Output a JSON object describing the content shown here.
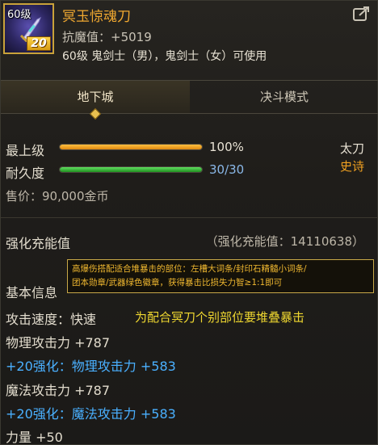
{
  "item": {
    "level_badge": "60级",
    "upgrade_badge": "20",
    "name": "冥玉惊魂刀",
    "resist": "抗魔值：+5019",
    "usable": "60级 鬼剑士（男），鬼剑士（女）可使用"
  },
  "tabs": [
    {
      "label": "地下城",
      "active": true
    },
    {
      "label": "决斗模式",
      "active": false
    }
  ],
  "bars": {
    "max_level_label": "最上级",
    "max_level_value": "100%",
    "max_level_fraction": 1.0,
    "durability_label": "耐久度",
    "durability_value": "30/30",
    "durability_fraction": 1.0
  },
  "weapon_type": "太刀",
  "rarity": "史诗",
  "price": "售价：90,000金币",
  "enhance": {
    "label": "强化充能值",
    "value": "（强化充能值：14110638）"
  },
  "tooltip": {
    "line1": "高爆伤搭配适合堆暴击的部位：左槽大词条/封印石精髓小词条/",
    "line2": "团本勋章/武器绿色徽章，获得暴击比损失力智≥1:1即可"
  },
  "basic_info": {
    "title": "基本信息",
    "attack_speed": "攻击速度：快速",
    "note": "为配合冥刀个别部位要堆叠暴击",
    "phys": "物理攻击力 +787",
    "phys_enh": "+20强化：物理攻击力 +583",
    "magic": "魔法攻击力 +787",
    "magic_enh": "+20强化：魔法攻击力 +583",
    "strength": "力量 +50"
  },
  "colors": {
    "name": "#f0a830",
    "bar_orange": "#f0a020",
    "bar_green": "#40c040",
    "rarity": "#f0a020",
    "enhance_blue": "#4ab0ff",
    "note_yellow": "#f0d830"
  }
}
